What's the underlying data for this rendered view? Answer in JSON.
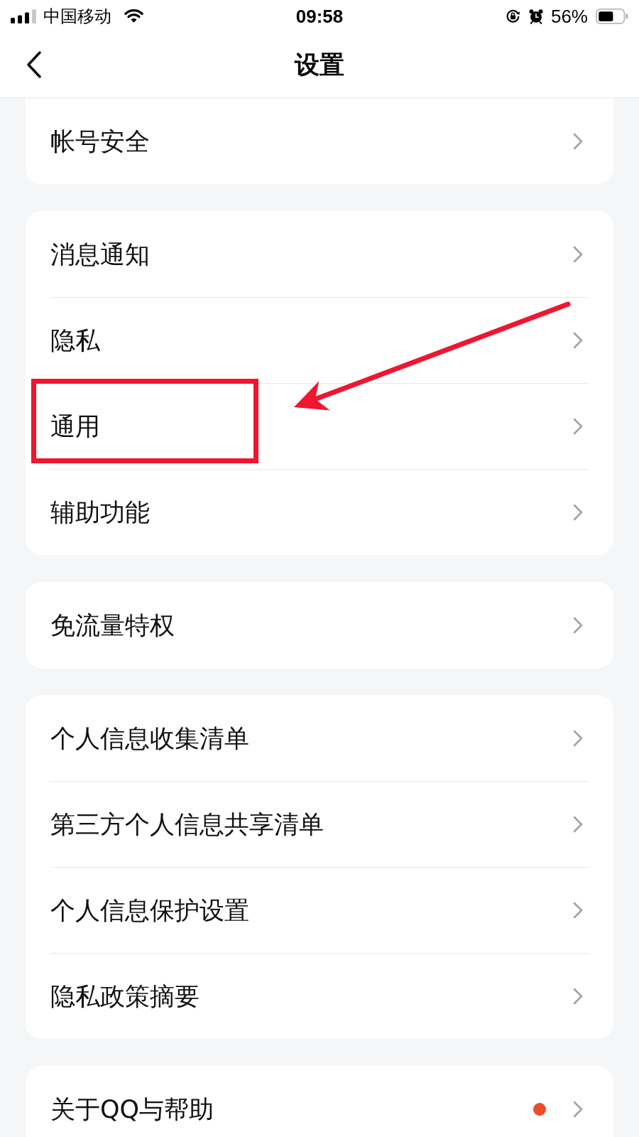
{
  "status_bar": {
    "carrier": "中国移动",
    "time": "09:58",
    "battery_text": "56%"
  },
  "nav_bar": {
    "title": "设置"
  },
  "groups": [
    {
      "items": [
        {
          "label": "帐号安全",
          "highlighted": false,
          "dot": false
        }
      ]
    },
    {
      "items": [
        {
          "label": "消息通知",
          "highlighted": false,
          "dot": false
        },
        {
          "label": "隐私",
          "highlighted": false,
          "dot": false
        },
        {
          "label": "通用",
          "highlighted": true,
          "dot": false
        },
        {
          "label": "辅助功能",
          "highlighted": false,
          "dot": false
        }
      ]
    },
    {
      "items": [
        {
          "label": "免流量特权",
          "highlighted": false,
          "dot": false
        }
      ]
    },
    {
      "items": [
        {
          "label": "个人信息收集清单",
          "highlighted": false,
          "dot": false
        },
        {
          "label": "第三方个人信息共享清单",
          "highlighted": false,
          "dot": false
        },
        {
          "label": "个人信息保护设置",
          "highlighted": false,
          "dot": false
        },
        {
          "label": "隐私政策摘要",
          "highlighted": false,
          "dot": false
        }
      ]
    },
    {
      "items": [
        {
          "label": "关于QQ与帮助",
          "highlighted": false,
          "dot": true
        }
      ]
    }
  ]
}
